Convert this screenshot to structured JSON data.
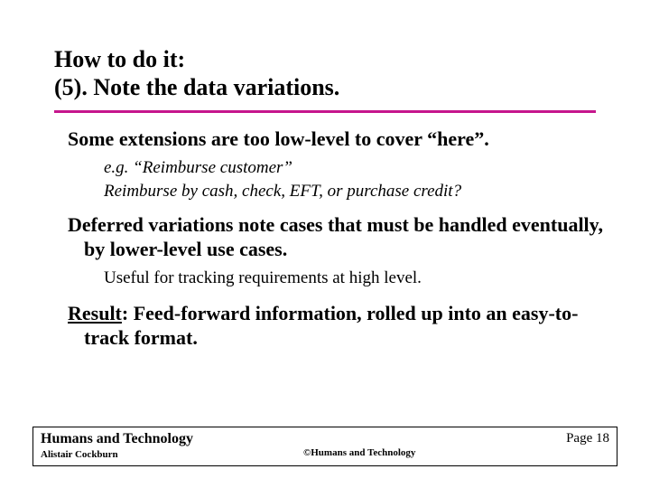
{
  "title": {
    "line1": "How to do it:",
    "line2": "(5). Note the data variations."
  },
  "content": {
    "p1": "Some extensions are too low-level to cover “here”.",
    "p1_sub1": "e.g. “Reimburse customer”",
    "p1_sub2": "Reimburse by cash, check, EFT, or purchase credit?",
    "p2": "Deferred variations note cases that must be handled eventually, by lower-level use cases.",
    "p2_sub1": "Useful for tracking requirements at high level.",
    "p3_label": "Result",
    "p3_rest": ": Feed-forward information, rolled up into an easy-to-track format."
  },
  "footer": {
    "org": "Humans and Technology",
    "author": "Alistair Cockburn",
    "copyright": "©Humans and Technology",
    "page_label": "Page",
    "page_number": "18"
  }
}
